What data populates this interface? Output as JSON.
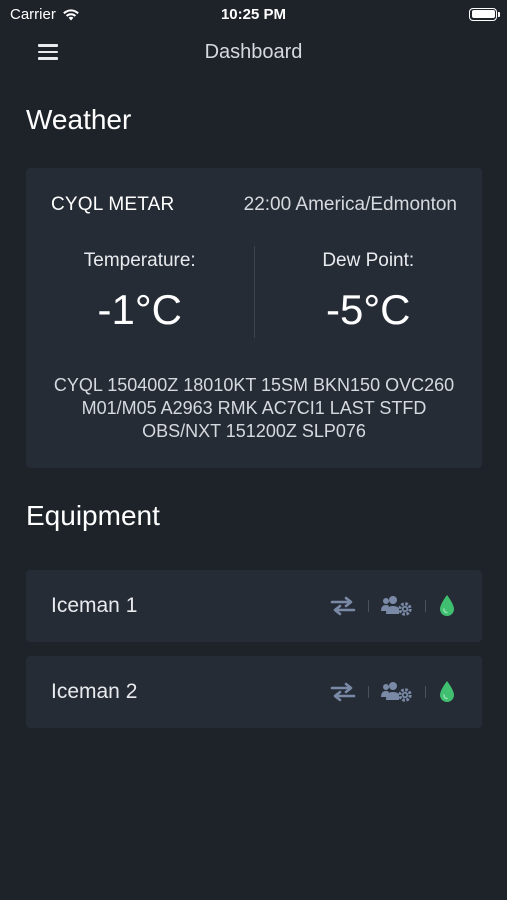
{
  "status_bar": {
    "carrier": "Carrier",
    "time": "10:25 PM"
  },
  "nav": {
    "title": "Dashboard",
    "menu_icon": "hamburger-menu-icon"
  },
  "weather": {
    "section_title": "Weather",
    "station": "CYQL METAR",
    "observation_time": "22:00 America/Edmonton",
    "temperature_label": "Temperature:",
    "temperature_value": "-1°C",
    "dew_point_label": "Dew Point:",
    "dew_point_value": "-5°C",
    "metar_raw": "CYQL 150400Z 18010KT 15SM BKN150 OVC260 M01/M05 A2963 RMK AC7CI1 LAST STFD OBS/NXT 151200Z SLP076"
  },
  "equipment": {
    "section_title": "Equipment",
    "items": [
      {
        "name": "Iceman 1",
        "icons": [
          "transfer-arrows-icon",
          "users-cog-icon",
          "fluid-drop-icon"
        ]
      },
      {
        "name": "Iceman 2",
        "icons": [
          "transfer-arrows-icon",
          "users-cog-icon",
          "fluid-drop-icon"
        ]
      }
    ]
  },
  "colors": {
    "background": "#1e232a",
    "card": "#262c36",
    "icon_muted": "#7a8aa6",
    "drop_green": "#3fbf6f"
  }
}
